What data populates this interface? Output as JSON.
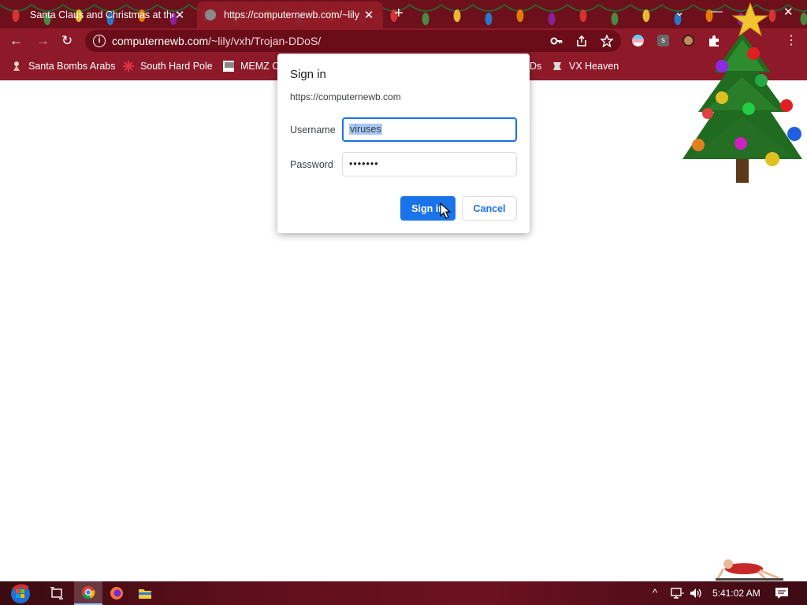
{
  "tabs": [
    {
      "title": "Santa Claus and Christmas at the",
      "active": false
    },
    {
      "title": "https://computernewb.com/~lily",
      "active": true
    }
  ],
  "window_controls": {
    "menu": "⌄",
    "minimize": "—",
    "maximize": "▢",
    "close": "✕"
  },
  "toolbar": {
    "back": "←",
    "forward": "→",
    "reload": "↻",
    "url_host": "computernewb.com",
    "url_path": "/~lily/vxh/Trojan-DDoS/"
  },
  "bookmarks": [
    {
      "label": "Santa Bombs Arabs"
    },
    {
      "label": "South Hard Pole"
    },
    {
      "label": "MEMZ C"
    },
    {
      "label": "Ds"
    },
    {
      "label": "VX Heaven"
    }
  ],
  "dialog": {
    "title": "Sign in",
    "origin": "https://computernewb.com",
    "username_label": "Username",
    "username_value": "viruses",
    "password_label": "Password",
    "password_value": "•••••••",
    "sign_in_label": "Sign in",
    "cancel_label": "Cancel"
  },
  "taskbar": {
    "clock": "5:41:02 AM"
  },
  "colors": {
    "tab_strip": "#6e0f1c",
    "toolbar": "#8e1a29",
    "accent": "#1a73e8"
  }
}
